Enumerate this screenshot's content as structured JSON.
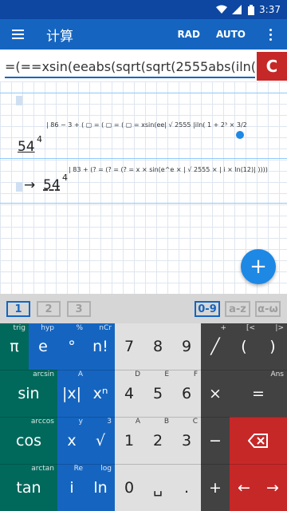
{
  "status": {
    "time": "3:37"
  },
  "appbar": {
    "title": "计算",
    "rad": "RAD",
    "auto": "AUTO"
  },
  "input": {
    "text": "=(==xsin(eeabs(sqrt(sqrt(2555abs(iln(1",
    "clear": "C"
  },
  "work": {
    "expr1": "| 86 − 3 + ( ▢ = ( ▢ = ( ▢ = xsin(ee| √ 2555 |iln( 1 + 2³ × 3/2",
    "result1": "54",
    "result1_exp": "4",
    "expr2": "| 83 + (? = (? = (? = x × sin(e^e × | √ 2555 × | i × ln(12)| ))))",
    "arrow": "→",
    "result2": "54",
    "result2_exp": "4"
  },
  "fab": "+",
  "tabs": [
    {
      "label": "1"
    },
    {
      "label": "2"
    },
    {
      "label": "3"
    },
    {
      "label": "0-9"
    },
    {
      "label": "a-z"
    },
    {
      "label": "α-ω"
    }
  ],
  "keys": {
    "pi": "π",
    "e": "e",
    "deg": "°",
    "fact": "n!",
    "seven": "7",
    "eight": "8",
    "nine": "9",
    "slash": "╱",
    "lparen": "(",
    "rparen": ")",
    "sin": "sin",
    "abs": "|x|",
    "pow": "xⁿ",
    "four": "4",
    "five": "5",
    "six": "6",
    "times": "×",
    "eq": "=",
    "cos": "cos",
    "x": "x",
    "sqrt": "√",
    "one": "1",
    "two": "2",
    "three": "3",
    "minus": "−",
    "tan": "tan",
    "i": "i",
    "ln": "ln",
    "zero": "0",
    "space": "␣",
    "dot": ".",
    "plus": "+",
    "left": "←",
    "right": "→"
  },
  "hints": {
    "trig": "trig",
    "hyp": "hyp",
    "pct": "%",
    "ncr": "nCr",
    "arcsin": "arcsin",
    "A": "A",
    "D": "D",
    "E": "E",
    "F": "F",
    "ans": "Ans",
    "arccos": "arccos",
    "y": "y",
    "three": "3",
    "A2": "A",
    "B": "B",
    "C": "C",
    "arctan": "arctan",
    "re": "Re",
    "log": "log",
    "plus": "+",
    "lbracket": "[<",
    "rbracket": "|>"
  }
}
